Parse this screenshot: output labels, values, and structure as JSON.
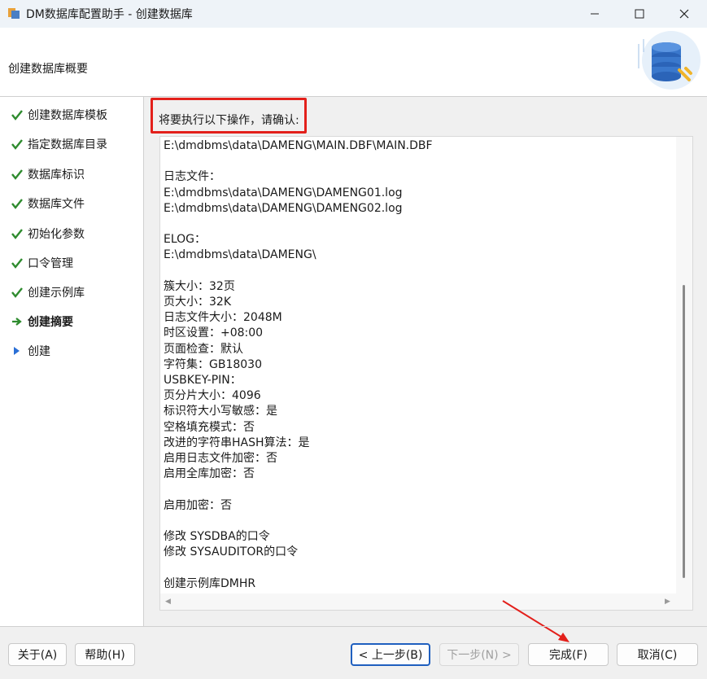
{
  "window": {
    "title": "DM数据库配置助手 - 创建数据库",
    "controls": [
      "minimize",
      "maximize",
      "close"
    ]
  },
  "header": {
    "title": "创建数据库概要"
  },
  "steps": [
    {
      "label": "创建数据库模板",
      "status": "done"
    },
    {
      "label": "指定数据库目录",
      "status": "done"
    },
    {
      "label": "数据库标识",
      "status": "done"
    },
    {
      "label": "数据库文件",
      "status": "done"
    },
    {
      "label": "初始化参数",
      "status": "done"
    },
    {
      "label": "口令管理",
      "status": "done"
    },
    {
      "label": "创建示例库",
      "status": "done"
    },
    {
      "label": "创建摘要",
      "status": "current"
    },
    {
      "label": "创建",
      "status": "pending"
    }
  ],
  "main": {
    "prompt": "将要执行以下操作，请确认:",
    "summary_lines": [
      "E:\\dmdbms\\data\\DAMENG\\MAIN.DBF\\MAIN.DBF",
      "",
      "日志文件：",
      "E:\\dmdbms\\data\\DAMENG\\DAMENG01.log",
      "E:\\dmdbms\\data\\DAMENG\\DAMENG02.log",
      "",
      "ELOG：",
      "E:\\dmdbms\\data\\DAMENG\\",
      "",
      "簇大小：32页",
      "页大小：32K",
      "日志文件大小：2048M",
      "时区设置：+08:00",
      "页面检查：默认",
      "字符集：GB18030",
      "USBKEY-PIN：",
      "页分片大小：4096",
      "标识符大小写敏感：是",
      "空格填充模式：否",
      "改进的字符串HASH算法：是",
      "启用日志文件加密：否",
      "启用全库加密：否",
      "",
      "启用加密：否",
      "",
      "修改 SYSDBA的口令",
      "修改 SYSAUDITOR的口令",
      "",
      "创建示例库DMHR"
    ]
  },
  "buttons": {
    "about": "关于(A)",
    "help": "帮助(H)",
    "back": "< 上一步(B)",
    "next": "下一步(N) >",
    "finish": "完成(F)",
    "cancel": "取消(C)"
  },
  "colors": {
    "highlight": "#e3201b",
    "check": "#2e8b2e",
    "current_arrow": "#2e8b2e",
    "pending_arrow": "#2a6fd6"
  }
}
